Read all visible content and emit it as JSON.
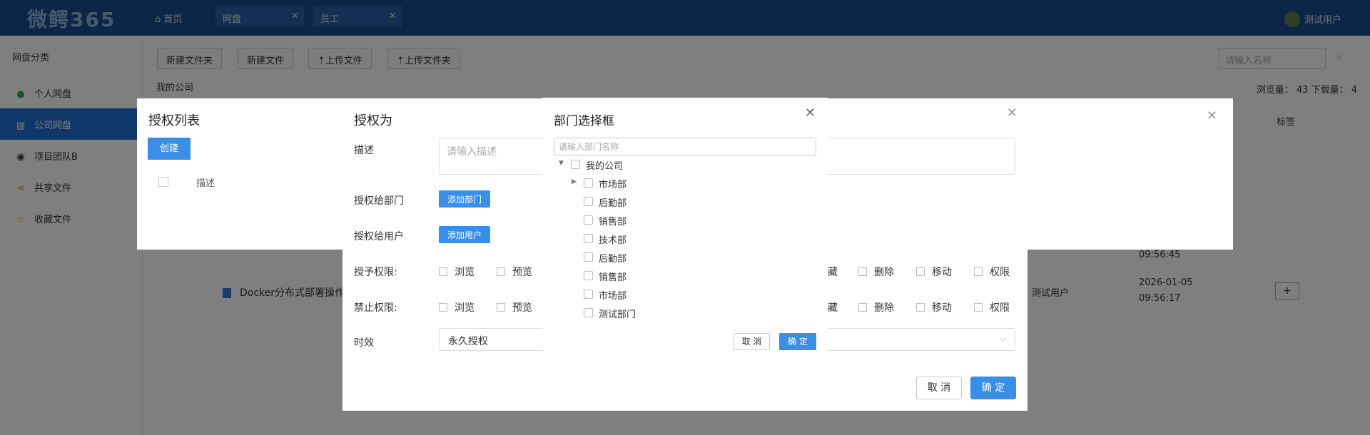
{
  "app": {
    "logo": "微鳄365",
    "home": "⌂ 首页"
  },
  "tabs": [
    {
      "label": "网盘"
    },
    {
      "label": "员工"
    }
  ],
  "user": {
    "name": "测试用户"
  },
  "sidebar": {
    "title": "网盘分类",
    "items": [
      {
        "label": "个人网盘",
        "icon": "user-icon"
      },
      {
        "label": "公司网盘",
        "icon": "building-icon"
      },
      {
        "label": "项目团队B",
        "icon": "team-icon"
      },
      {
        "label": "共享文件",
        "icon": "share-icon"
      },
      {
        "label": "收藏文件",
        "icon": "star-icon"
      }
    ]
  },
  "toolbar": {
    "new_folder": "新建文件夹",
    "new_file": "新建文件",
    "upload_file": "⇡上传文件",
    "upload_folder": "⇡上传文件夹",
    "search_placeholder": "请输入名称"
  },
  "main": {
    "breadcrumb": "我的公司",
    "stats": "浏览量： 43  下载量： 4",
    "col_tag": "标签",
    "rows": [
      {
        "time_line2": "09:56:45"
      },
      {
        "name": "Docker分布式部署操作文档",
        "owner": "测试用户",
        "time_line1": "2026-01-05",
        "time_line2": "09:56:17"
      }
    ]
  },
  "dialog_list": {
    "title": "授权列表",
    "create": "创建",
    "col_desc": "描述"
  },
  "dialog_grant": {
    "title": "授权为",
    "desc_label": "描述",
    "desc_placeholder": "请输入描述",
    "dept_label": "授权给部门",
    "add_dept": "添加部门",
    "user_label": "授权给用户",
    "add_user": "添加用户",
    "grant_label": "授予权限:",
    "deny_label": "禁止权限:",
    "perms_left": [
      "浏览",
      "预览"
    ],
    "perms_right": [
      "藏",
      "删除",
      "移动",
      "权限"
    ],
    "time_label": "时效",
    "time_value": "永久授权",
    "cancel": "取 消",
    "ok": "确 定"
  },
  "dialog_dept": {
    "title": "部门选择框",
    "search_placeholder": "请输入部门名称",
    "root": "我的公司",
    "children": [
      "市场部",
      "后勤部",
      "销售部",
      "技术部",
      "后勤部",
      "销售部",
      "市场部",
      "测试部门"
    ],
    "cancel": "取 消",
    "ok": "确 定"
  }
}
